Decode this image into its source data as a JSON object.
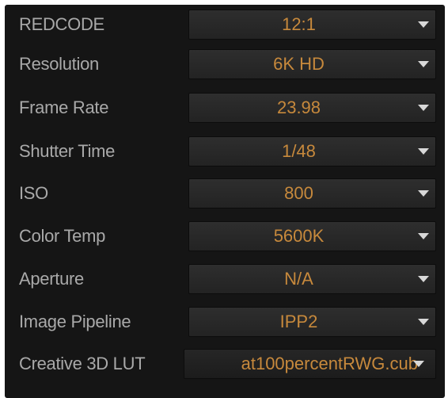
{
  "settings": {
    "rows": [
      {
        "label": "REDCODE",
        "value": "12:1"
      },
      {
        "label": "Resolution",
        "value": "6K HD"
      },
      {
        "label": "Frame Rate",
        "value": "23.98"
      },
      {
        "label": "Shutter Time",
        "value": "1/48"
      },
      {
        "label": "ISO",
        "value": "800"
      },
      {
        "label": "Color Temp",
        "value": "5600K"
      },
      {
        "label": "Aperture",
        "value": "N/A"
      },
      {
        "label": "Image Pipeline",
        "value": "IPP2"
      },
      {
        "label": "Creative 3D LUT",
        "value": "at100percentRWG.cub"
      }
    ]
  },
  "colors": {
    "panel_background": "#151515",
    "label_text": "#a9a9a9",
    "value_text": "#c7893c",
    "caret": "#d8d8d8"
  },
  "icons": {
    "dropdown_caret": "chevron-down-icon"
  }
}
